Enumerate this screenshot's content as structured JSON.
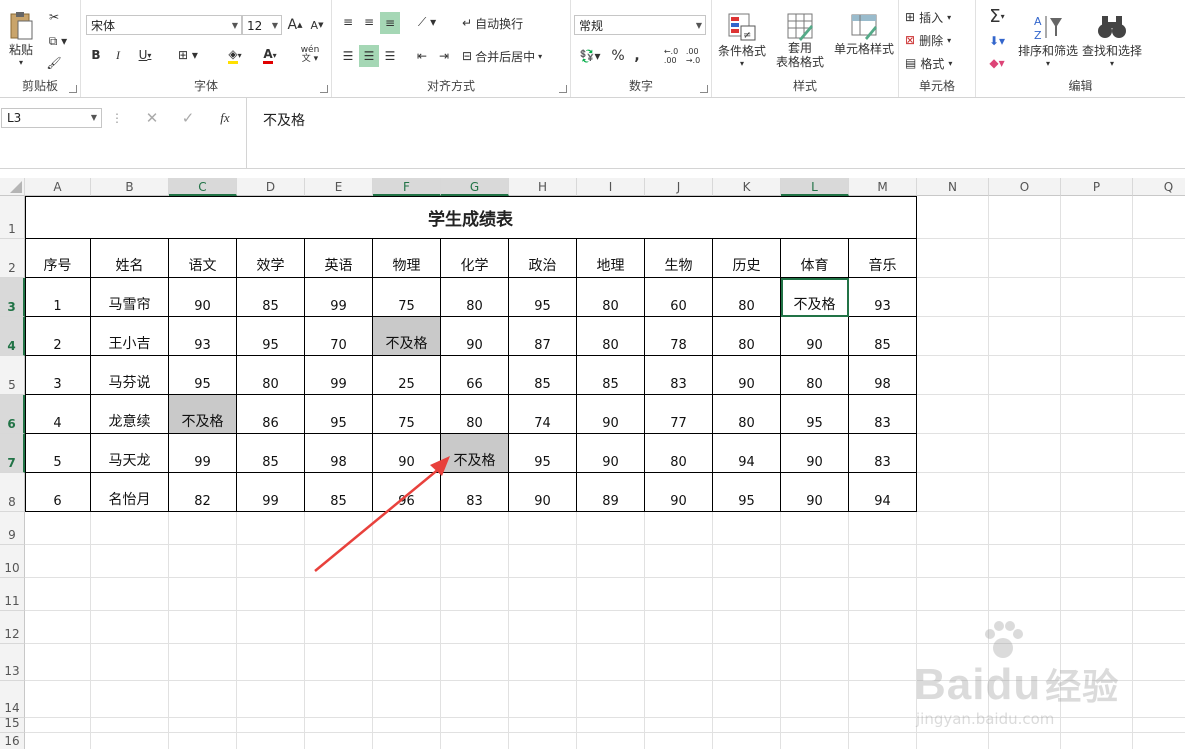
{
  "ribbon": {
    "clipboard": {
      "paste": "粘贴",
      "label": "剪贴板"
    },
    "font": {
      "name": "宋体",
      "size": "12",
      "bold": "B",
      "italic": "I",
      "underline": "U",
      "label": "字体",
      "wen": "wén",
      "grow": "A",
      "shrink": "A"
    },
    "alignment": {
      "wrap": "自动换行",
      "merge": "合并后居中",
      "label": "对齐方式"
    },
    "number": {
      "format": "常规",
      "percent": "%",
      "comma": ",",
      "label": "数字",
      "inc": "←.0 .00",
      "dec": ".00 →.0"
    },
    "styles": {
      "conditional": "条件格式",
      "table_line1": "套用",
      "table_line2": "表格格式",
      "cell_styles": "单元格样式",
      "label": "样式"
    },
    "cells": {
      "insert": "插入",
      "delete": "删除",
      "format": "格式",
      "label": "单元格"
    },
    "editing": {
      "sigma": "Σ",
      "sort": "排序和筛选",
      "find": "查找和选择",
      "label": "编辑"
    }
  },
  "formula_bar": {
    "name_box": "L3",
    "fx": "fx",
    "content": "不及格"
  },
  "sheet": {
    "columns": [
      "A",
      "B",
      "C",
      "D",
      "E",
      "F",
      "G",
      "H",
      "I",
      "J",
      "K",
      "L",
      "M",
      "N",
      "O",
      "P",
      "Q"
    ],
    "selected_columns": [
      "C",
      "F",
      "G",
      "L"
    ],
    "rows": [
      "1",
      "2",
      "3",
      "4",
      "5",
      "6",
      "7",
      "8",
      "9",
      "10",
      "11",
      "12",
      "13",
      "14",
      "15",
      "16"
    ],
    "selected_rows": [
      "3",
      "4",
      "6",
      "7"
    ],
    "title": "学生成绩表",
    "headers": [
      "序号",
      "姓名",
      "语文",
      "效学",
      "英语",
      "物理",
      "化学",
      "政治",
      "地理",
      "生物",
      "历史",
      "体育",
      "音乐"
    ],
    "data": [
      [
        "1",
        "马雪帘",
        "90",
        "85",
        "99",
        "75",
        "80",
        "95",
        "80",
        "60",
        "80",
        "不及格",
        "93"
      ],
      [
        "2",
        "王小吉",
        "93",
        "95",
        "70",
        "不及格",
        "90",
        "87",
        "80",
        "78",
        "80",
        "90",
        "85"
      ],
      [
        "3",
        "马芬说",
        "95",
        "80",
        "99",
        "25",
        "66",
        "85",
        "85",
        "83",
        "90",
        "80",
        "98"
      ],
      [
        "4",
        "龙意续",
        "不及格",
        "86",
        "95",
        "75",
        "80",
        "74",
        "90",
        "77",
        "80",
        "95",
        "83"
      ],
      [
        "5",
        "马天龙",
        "99",
        "85",
        "98",
        "90",
        "不及格",
        "95",
        "90",
        "80",
        "94",
        "90",
        "83"
      ],
      [
        "6",
        "名怡月",
        "82",
        "99",
        "85",
        "96",
        "83",
        "90",
        "89",
        "90",
        "95",
        "90",
        "94"
      ]
    ],
    "active_cell": "L3",
    "fail_text": "不及格"
  },
  "watermark": {
    "brand": "Baidu",
    "cn": "经验",
    "url": "jingyan.baidu.com"
  },
  "colors": {
    "accent": "#217346",
    "highlight": "#c9c9c9",
    "arrow": "#e8413c"
  }
}
